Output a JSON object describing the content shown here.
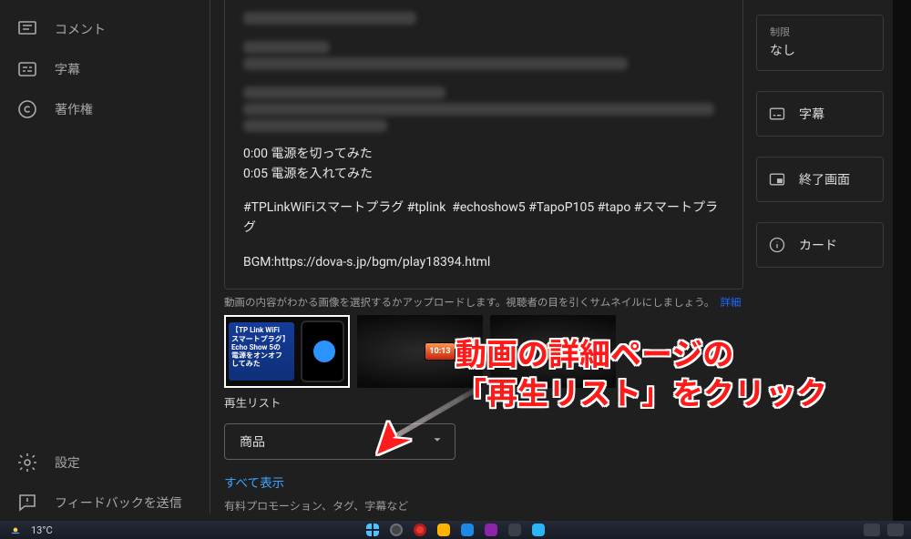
{
  "sidebar": {
    "top": [
      {
        "id": "comments",
        "label": "コメント"
      },
      {
        "id": "subtitles",
        "label": "字幕"
      },
      {
        "id": "copyright",
        "label": "著作権"
      }
    ],
    "bottom": [
      {
        "id": "settings",
        "label": "設定"
      },
      {
        "id": "feedback",
        "label": "フィードバックを送信"
      }
    ]
  },
  "description": {
    "chapters": "0:00 電源を切ってみた\n0:05 電源を入れてみた",
    "hashtags": "#TPLinkWiFiスマートプラグ #tplink  #echoshow5 #TapoP105 #tapo #スマートプラグ",
    "bgm": "BGM:https://dova-s.jp/bgm/play18394.html"
  },
  "thumbnail": {
    "help_text": "動画の内容がわかる画像を選択するかアップロードします。視聴者の目を引くサムネイルにしましょう。",
    "help_link": "詳細",
    "card_text": "【TP Link WiFi\nスマートプラグ】\nEcho Show 5の\n電源をオンオフ\nしてみた",
    "badge_a": "10:13",
    "badge_b": "10:13"
  },
  "playlist": {
    "section_label": "再生リスト",
    "selected_value": "商品",
    "show_all": "すべて表示",
    "more_label": "有料プロモーション、タグ、字幕など"
  },
  "rightcol": {
    "restrict_label": "制限",
    "restrict_value": "なし",
    "subtitles": "字幕",
    "endscreen": "終了画面",
    "cards": "カード"
  },
  "taskbar": {
    "temp": "13°C"
  },
  "annotation": {
    "line1": "動画の詳細ページの",
    "line2": "「再生リスト」をクリック"
  }
}
